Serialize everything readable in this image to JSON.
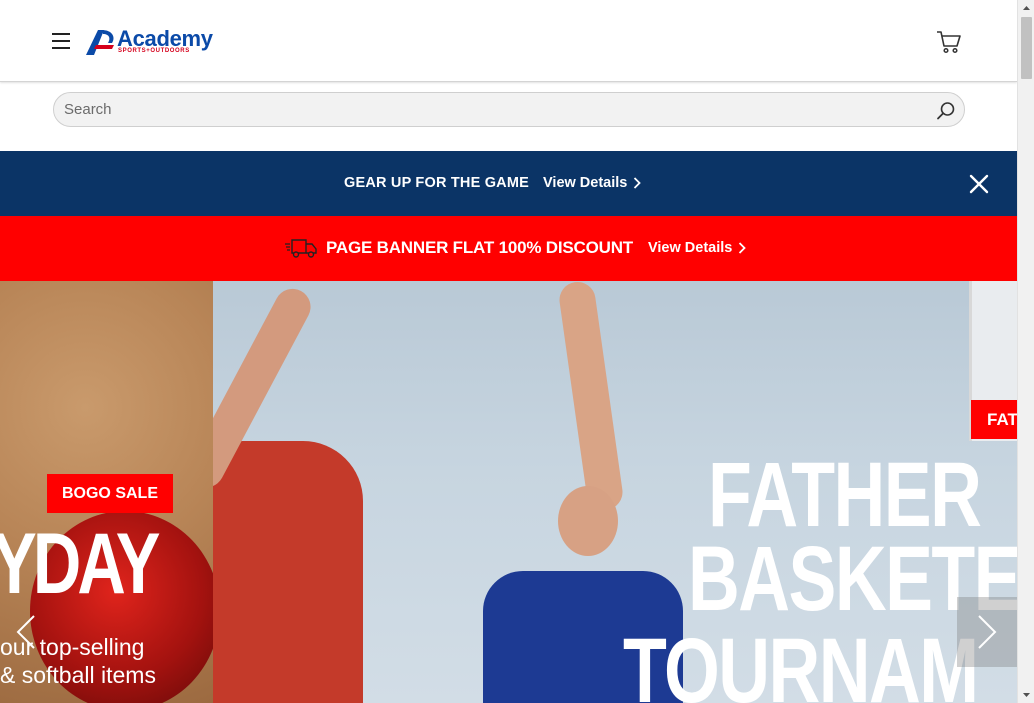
{
  "header": {
    "logo_text": "Academy",
    "logo_tagline": "SPORTS+OUTDOORS"
  },
  "search": {
    "placeholder": "Search"
  },
  "banners": {
    "primary": {
      "title": "GEAR UP FOR THE GAME",
      "link_label": "View Details"
    },
    "secondary": {
      "title": "PAGE BANNER FLAT 100% DISCOUNT",
      "link_label": "View Details"
    }
  },
  "hero": {
    "left_slide": {
      "badge": "BOGO SALE",
      "headline": "YDAY",
      "subtext_line1": "our top-selling",
      "subtext_line2": "& softball items"
    },
    "right_slide": {
      "badge": "FAT",
      "headline_line1": "FATHER",
      "headline_line2": "BASKETE",
      "headline_line3": "TOURNAM"
    }
  },
  "colors": {
    "primary_banner_bg": "#0b3466",
    "secondary_banner_bg": "#ff0000",
    "brand_blue": "#0b4aa8",
    "brand_red": "#d5001c"
  },
  "icons": {
    "menu": "hamburger-icon",
    "cart": "cart-icon",
    "search": "search-icon",
    "close": "close-icon",
    "truck": "truck-icon",
    "chevron": "chevron-right-icon"
  }
}
